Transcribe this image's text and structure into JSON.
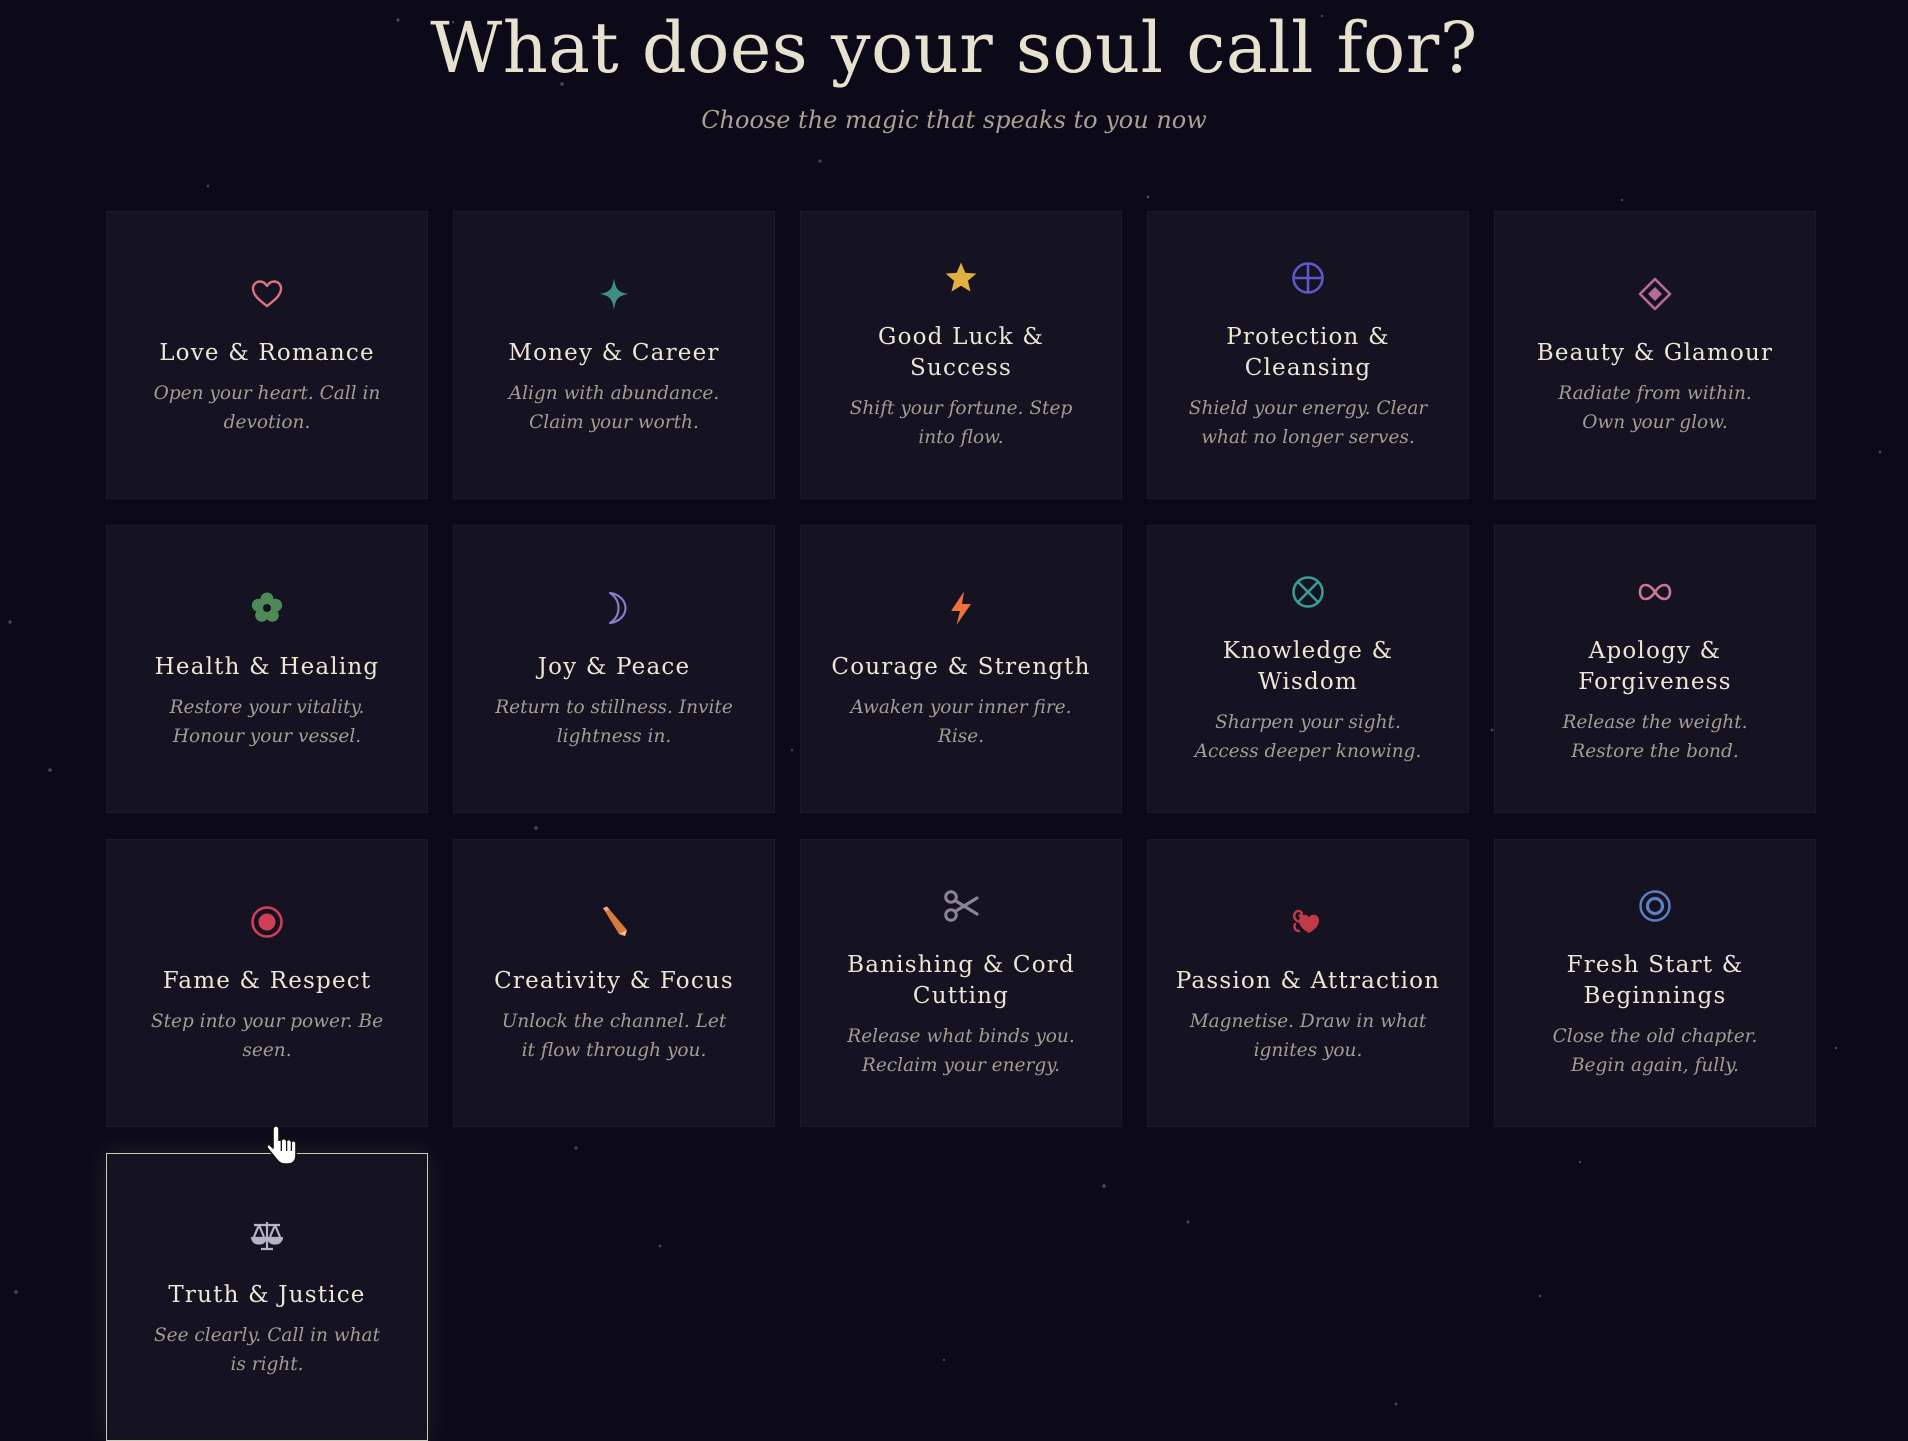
{
  "header": {
    "title": "What does your soul call for?",
    "subtitle": "Choose the magic that speaks to you now"
  },
  "categories": [
    {
      "title": "Love & Romance",
      "desc": "Open your heart. Call in devotion.",
      "icon": "heart-icon",
      "color": "#d9747f"
    },
    {
      "title": "Money & Career",
      "desc": "Align with abundance. Claim your worth.",
      "icon": "four-point-star-icon",
      "color": "#3f8f84"
    },
    {
      "title": "Good Luck & Success",
      "desc": "Shift your fortune. Step into flow.",
      "icon": "star-icon",
      "color": "#e0b040"
    },
    {
      "title": "Protection & Cleansing",
      "desc": "Shield your energy. Clear what no longer serves.",
      "icon": "circled-cross-icon",
      "color": "#5e58c9"
    },
    {
      "title": "Beauty & Glamour",
      "desc": "Radiate from within. Own your glow.",
      "icon": "diamond-icon",
      "color": "#b86a9b"
    },
    {
      "title": "Health & Healing",
      "desc": "Restore your vitality. Honour your vessel.",
      "icon": "flower-icon",
      "color": "#4e8a55"
    },
    {
      "title": "Joy & Peace",
      "desc": "Return to stillness. Invite lightness in.",
      "icon": "crescent-moon-icon",
      "color": "#8a7ac4"
    },
    {
      "title": "Courage & Strength",
      "desc": "Awaken your inner fire. Rise.",
      "icon": "lightning-icon",
      "color": "#f07040"
    },
    {
      "title": "Knowledge & Wisdom",
      "desc": "Sharpen your sight. Access deeper knowing.",
      "icon": "circled-x-icon",
      "color": "#3a9c96"
    },
    {
      "title": "Apology & Forgiveness",
      "desc": "Release the weight. Restore the bond.",
      "icon": "infinity-icon",
      "color": "#c87890"
    },
    {
      "title": "Fame & Respect",
      "desc": "Step into your power. Be seen.",
      "icon": "target-icon",
      "color": "#cf3f55"
    },
    {
      "title": "Creativity & Focus",
      "desc": "Unlock the channel. Let it flow through you.",
      "icon": "pencil-icon",
      "color": "#d87a3a"
    },
    {
      "title": "Banishing & Cord Cutting",
      "desc": "Release what binds you. Reclaim your energy.",
      "icon": "scissors-icon",
      "color": "#8a8494"
    },
    {
      "title": "Passion & Attraction",
      "desc": "Magnetise. Draw in what ignites you.",
      "icon": "heart-swirl-icon",
      "color": "#c23a48"
    },
    {
      "title": "Fresh Start & Beginnings",
      "desc": "Close the old chapter. Begin again, fully.",
      "icon": "ring-icon",
      "color": "#5f7fc4"
    },
    {
      "title": "Truth & Justice",
      "desc": "See clearly. Call in what is right.",
      "icon": "scales-icon",
      "color": "#b8b2c6"
    }
  ],
  "hovered_index": 15
}
